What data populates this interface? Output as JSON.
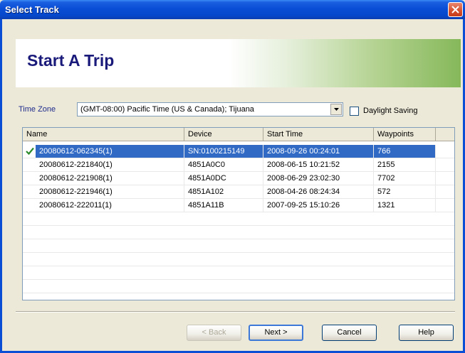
{
  "window": {
    "title": "Select Track"
  },
  "banner": {
    "title": "Start A Trip"
  },
  "timezone": {
    "label": "Time Zone",
    "selected": "(GMT-08:00) Pacific Time (US & Canada); Tijuana",
    "daylight_label": "Daylight Saving",
    "daylight_checked": false
  },
  "table": {
    "columns": [
      "Name",
      "Device",
      "Start Time",
      "Waypoints"
    ],
    "rows": [
      {
        "name": "20080612-062345(1)",
        "device": "SN:0100215149",
        "start": "2008-09-26 00:24:01",
        "waypoints": "766",
        "selected": true
      },
      {
        "name": "20080612-221840(1)",
        "device": "4851A0C0",
        "start": "2008-06-15 10:21:52",
        "waypoints": "2155"
      },
      {
        "name": "20080612-221908(1)",
        "device": "4851A0DC",
        "start": "2008-06-29 23:02:30",
        "waypoints": "7702"
      },
      {
        "name": "20080612-221946(1)",
        "device": "4851A102",
        "start": "2008-04-26 08:24:34",
        "waypoints": "572"
      },
      {
        "name": "20080612-222011(1)",
        "device": "4851A11B",
        "start": "2007-09-25 15:10:26",
        "waypoints": "1321"
      }
    ]
  },
  "buttons": {
    "back": "< Back",
    "next": "Next >",
    "cancel": "Cancel",
    "help": "Help"
  },
  "colors": {
    "title_bar": "#0a4ed6",
    "selection": "#316ac5",
    "banner_title": "#1a1a7a"
  }
}
